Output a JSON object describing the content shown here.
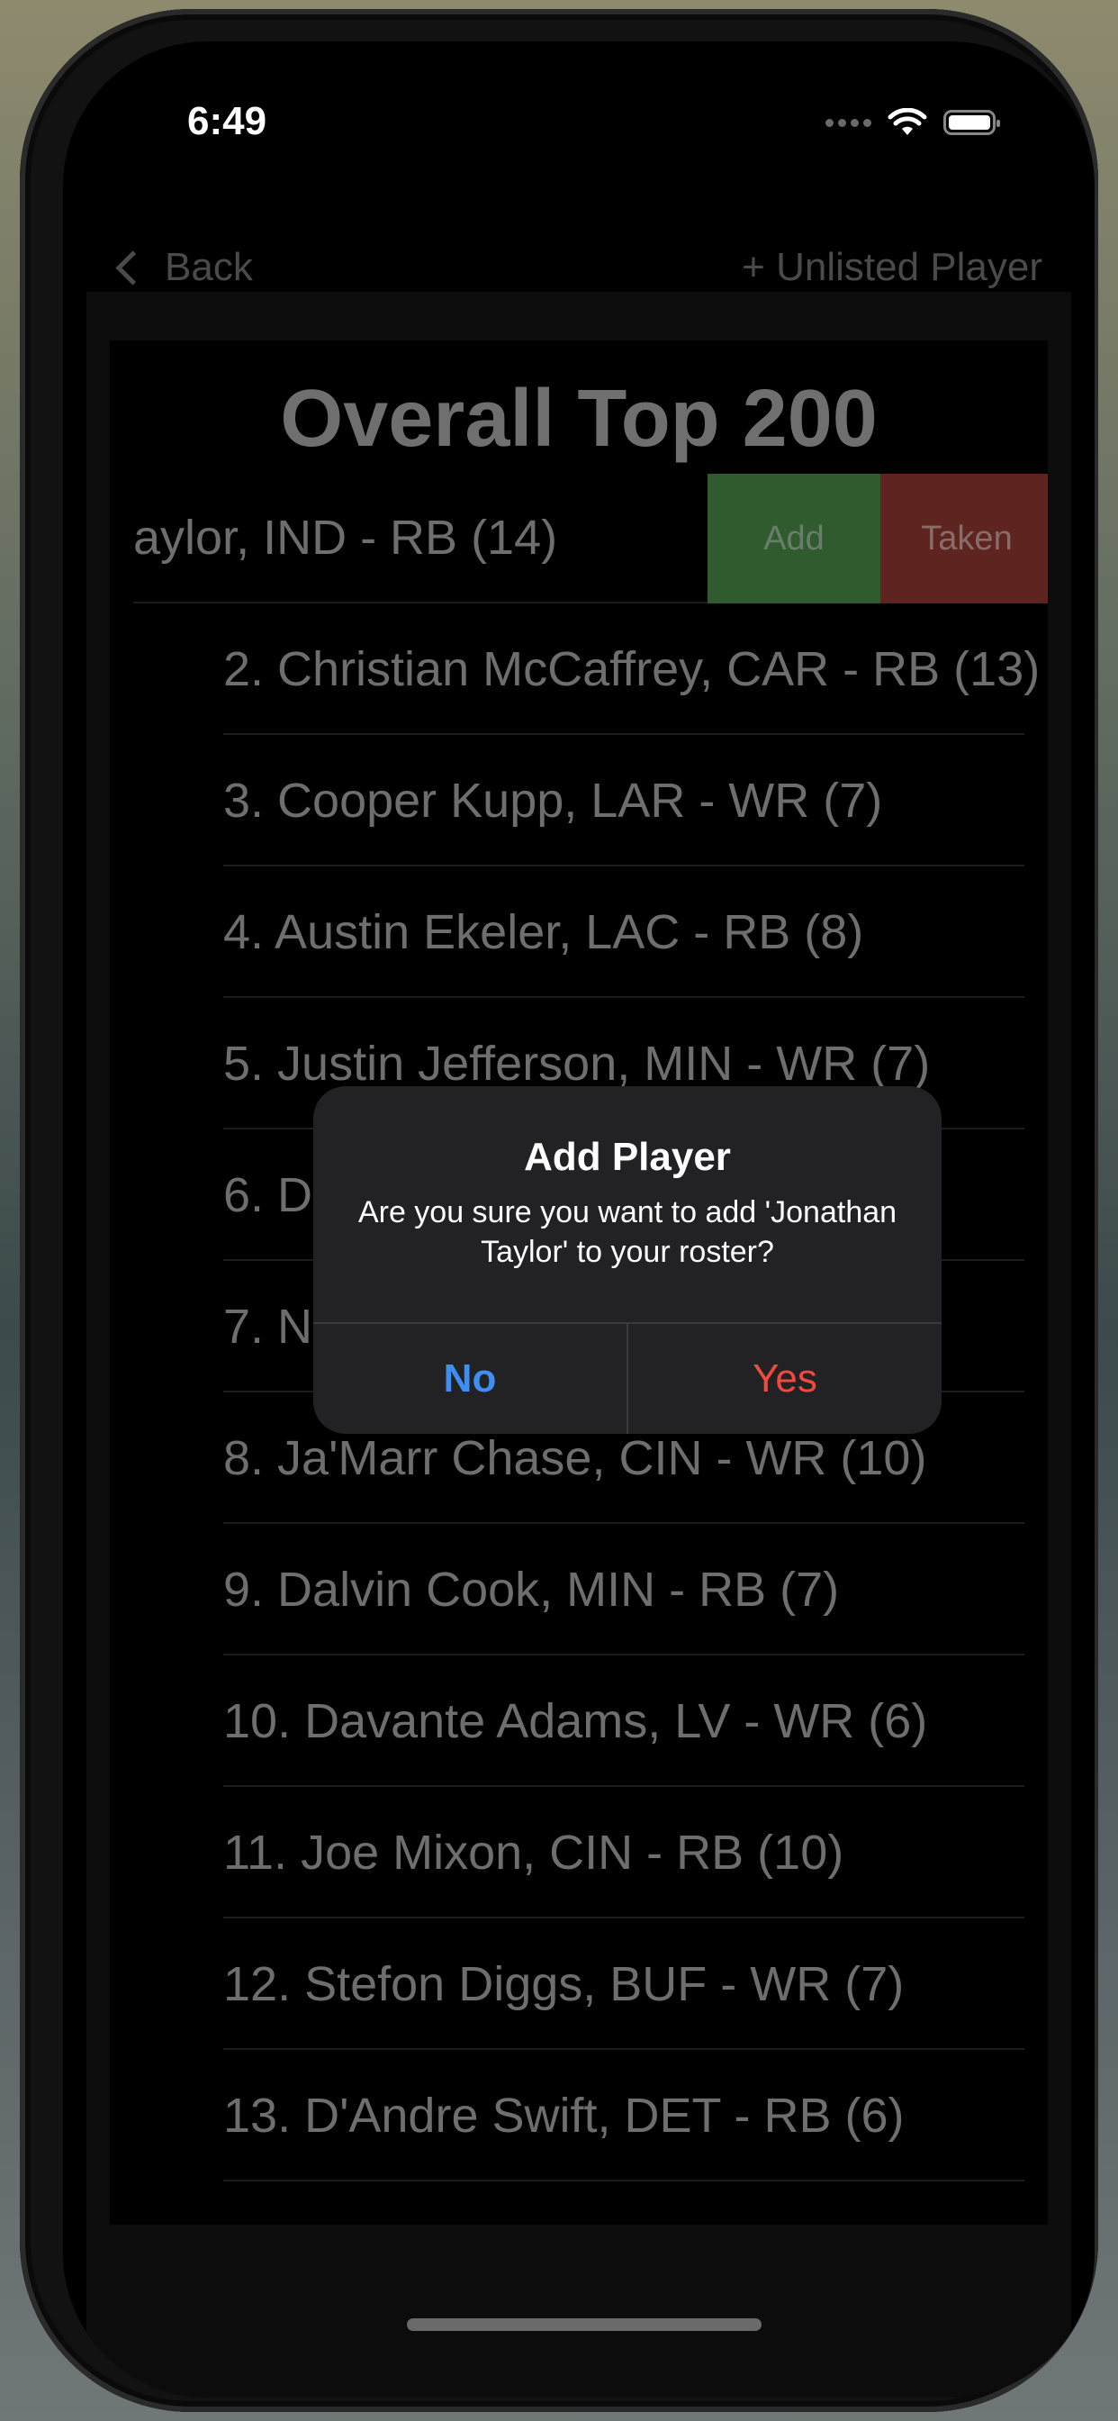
{
  "status_bar": {
    "time": "6:49"
  },
  "nav": {
    "back_label": "Back",
    "unlisted_label": "+ Unlisted Player"
  },
  "list": {
    "title": "Overall Top 200",
    "rows": [
      "aylor,  IND - RB (14)",
      "2.  Christian McCaffrey,  CAR - RB (13)",
      "3.  Cooper Kupp,  LAR - WR (7)",
      "4.  Austin Ekeler,  LAC - RB (8)",
      "5.  Justin Jefferson,  MIN - WR (7)",
      "6.  D",
      "7.  N",
      "8.  Ja'Marr Chase,  CIN - WR (10)",
      "9.  Dalvin Cook,  MIN - RB (7)",
      "10.  Davante Adams,  LV - WR (6)",
      "11.  Joe Mixon,  CIN - RB (10)",
      "12.  Stefon Diggs,  BUF - WR (7)",
      "13.  D'Andre Swift,  DET - RB (6)"
    ],
    "swipe_actions": {
      "add": "Add",
      "taken": "Taken"
    }
  },
  "alert": {
    "title": "Add Player",
    "message": "Are you sure you want to add 'Jonathan Taylor' to your roster?",
    "no_label": "No",
    "yes_label": "Yes"
  },
  "colors": {
    "alert_no": "#3f8ef5",
    "alert_yes": "#ef4a3d",
    "swipe_add": "#2f5b2f",
    "swipe_taken": "#5e2520"
  }
}
